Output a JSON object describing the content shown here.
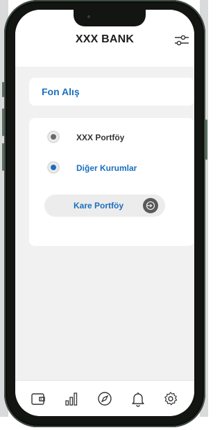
{
  "header": {
    "title": "XXX BANK"
  },
  "fund_card": {
    "label": "Fon Alış"
  },
  "options": [
    {
      "label": "XXX Portföy",
      "selected": false
    },
    {
      "label": "Diğer Kurumlar",
      "selected": true
    }
  ],
  "sub_option": {
    "label": "Kare Portföy"
  },
  "colors": {
    "accent": "#1a6fbd",
    "text_dark": "#333333",
    "background": "#f1f1f1"
  },
  "tabbar": {
    "icons": [
      "wallet-icon",
      "bar-chart-icon",
      "compass-icon",
      "bell-icon",
      "gear-icon"
    ]
  }
}
